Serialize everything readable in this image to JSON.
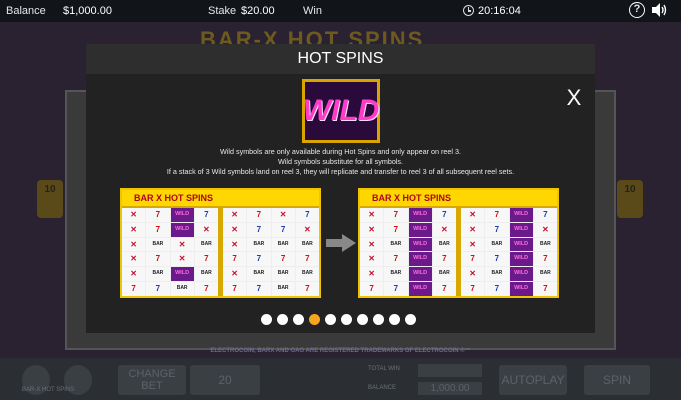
{
  "topbar": {
    "balance_label": "Balance",
    "balance_value": "$1,000.00",
    "stake_label": "Stake",
    "stake_value": "$20.00",
    "win_label": "Win",
    "time": "20:16:04"
  },
  "background": {
    "logo": "BAR-X HOT SPINS",
    "side_badge": "10",
    "trademark": "ELECTROCOIN, BARX AND GAG ARE REGISTERED TRADEMARKS OF ELECTROCOIN ®™",
    "game_name": "BAR-X HOT SPINS",
    "change_bet": "CHANGE BET",
    "bet_value": "20",
    "total_win_label": "TOTAL WIN",
    "balance_label": "BALANCE",
    "balance_value": "1,000.00",
    "autoplay": "AUTOPLAY",
    "spin": "SPIN"
  },
  "modal": {
    "title": "HOT SPINS",
    "close": "X",
    "wild_symbol_text": "WILD",
    "description": [
      "Wild symbols are only available during Hot Spins and only appear on reel 3.",
      "Wild symbols substitute for all symbols.",
      "If a stack of 3 Wild symbols land on reel 3, they will replicate and transfer to reel 3 of all subsequent reel sets."
    ],
    "panel_logo": "BAR X HOT SPINS",
    "page_count": 10,
    "active_page": 4,
    "active_color": "#f5a623"
  },
  "reel_example": {
    "symbol_text": {
      "x": "✕",
      "seven": "7",
      "bar": "BAR",
      "wild": "WILD",
      "cherry": "♥"
    },
    "before_left": [
      "x",
      "7r",
      "wild",
      "7b",
      "x",
      "7r",
      "wild",
      "x",
      "x",
      "bar",
      "x",
      "bar",
      "x",
      "7r",
      "x",
      "7r",
      "x",
      "bar",
      "wild",
      "bar",
      "7r",
      "7b",
      "bar",
      "7r"
    ],
    "before_right": [
      "x",
      "7r",
      "x",
      "7b",
      "x",
      "7b",
      "7b",
      "x",
      "x",
      "bar",
      "bar",
      "bar",
      "7r",
      "7b",
      "7r",
      "7r",
      "x",
      "bar",
      "bar",
      "bar",
      "7r",
      "7b",
      "bar",
      "7r"
    ],
    "after_left": [
      "x",
      "7r",
      "wild",
      "7b",
      "x",
      "7r",
      "wild",
      "x",
      "x",
      "bar",
      "wild",
      "bar",
      "x",
      "7r",
      "wild",
      "7r",
      "x",
      "bar",
      "wild",
      "bar",
      "7r",
      "7b",
      "wild",
      "7r"
    ],
    "after_right": [
      "x",
      "7r",
      "wild",
      "7b",
      "x",
      "7b",
      "wild",
      "x",
      "x",
      "bar",
      "wild",
      "bar",
      "7r",
      "7b",
      "wild",
      "7r",
      "x",
      "bar",
      "wild",
      "bar",
      "7r",
      "7b",
      "wild",
      "7r"
    ]
  }
}
